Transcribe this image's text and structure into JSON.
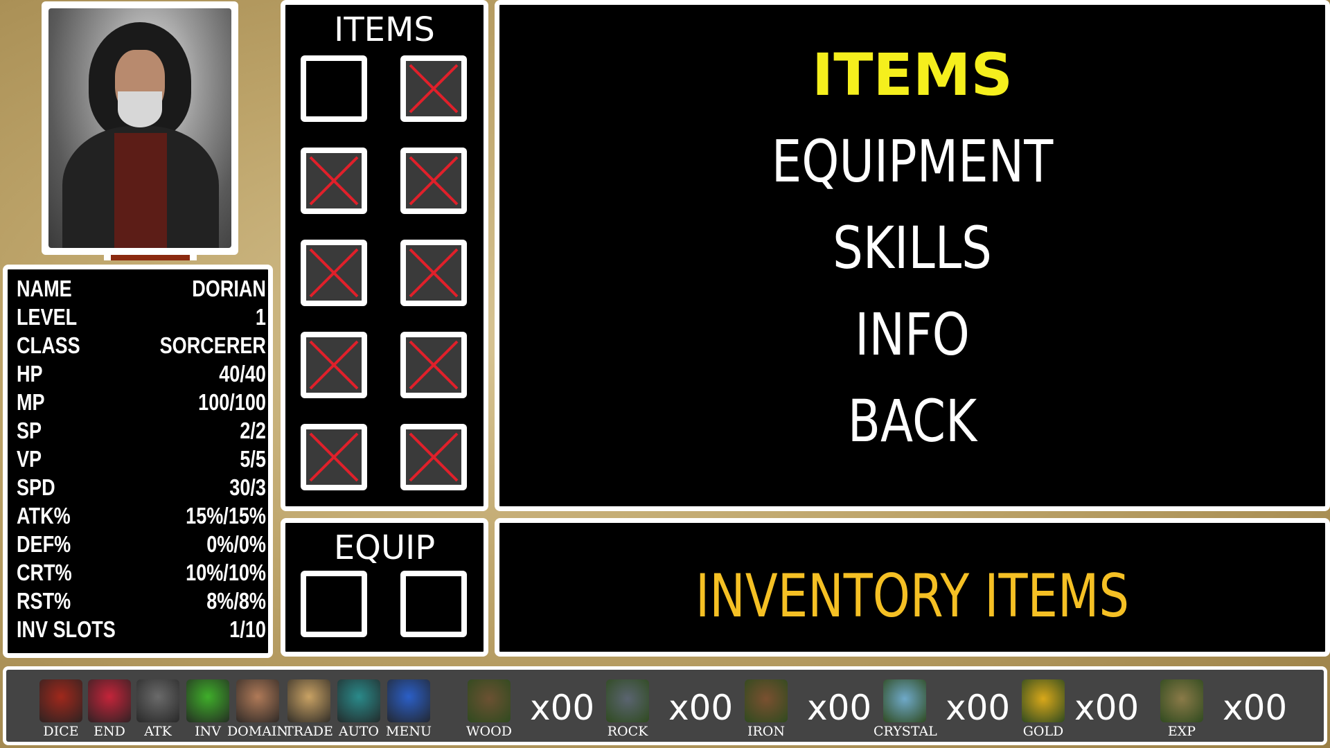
{
  "character": {
    "portrait_alt": "Sorcerer portrait",
    "stats": [
      {
        "label": "NAME",
        "value": "DORIAN"
      },
      {
        "label": "LEVEL",
        "value": "1"
      },
      {
        "label": "CLASS",
        "value": "SORCERER"
      },
      {
        "label": "HP",
        "value": "40/40"
      },
      {
        "label": "MP",
        "value": "100/100"
      },
      {
        "label": "SP",
        "value": "2/2"
      },
      {
        "label": "VP",
        "value": "5/5"
      },
      {
        "label": "SPD",
        "value": "30/3"
      },
      {
        "label": "ATK%",
        "value": "15%/15%"
      },
      {
        "label": "DEF%",
        "value": "0%/0%"
      },
      {
        "label": "CRT%",
        "value": "10%/10%"
      },
      {
        "label": "RST%",
        "value": "8%/8%"
      },
      {
        "label": "INV SLOTS",
        "value": "1/10"
      }
    ]
  },
  "items_panel": {
    "title": "ITEMS",
    "slots": [
      "empty",
      "locked",
      "locked",
      "locked",
      "locked",
      "locked",
      "locked",
      "locked",
      "locked",
      "locked"
    ]
  },
  "equip_panel": {
    "title": "EQUIP",
    "slots": [
      "empty",
      "empty"
    ]
  },
  "menu": {
    "items": [
      {
        "label": "ITEMS",
        "active": true
      },
      {
        "label": "EQUIPMENT",
        "active": false
      },
      {
        "label": "SKILLS",
        "active": false
      },
      {
        "label": "INFO",
        "active": false
      },
      {
        "label": "BACK",
        "active": false
      }
    ]
  },
  "info": {
    "text": "INVENTORY ITEMS"
  },
  "action_bar": [
    {
      "label": "DICE",
      "icon": "dice-icon",
      "color": "#a0281c"
    },
    {
      "label": "END",
      "icon": "end-turn-icon",
      "color": "#c4243a"
    },
    {
      "label": "ATK",
      "icon": "crossed-swords-icon",
      "color": "#6a6a6a"
    },
    {
      "label": "INV",
      "icon": "backpack-icon",
      "color": "#3fae2a"
    },
    {
      "label": "DOMAIN",
      "icon": "castle-icon",
      "color": "#b07a58"
    },
    {
      "label": "TRADE",
      "icon": "trade-icon",
      "color": "#c9a264"
    },
    {
      "label": "AUTO",
      "icon": "auto-icon",
      "color": "#2a8a8a"
    },
    {
      "label": "MENU",
      "icon": "gear-icon",
      "color": "#2b5fc7"
    }
  ],
  "resources": [
    {
      "label": "WOOD",
      "icon": "wood-icon",
      "count": "x00",
      "color": "#6b5132"
    },
    {
      "label": "ROCK",
      "icon": "rock-icon",
      "count": "x00",
      "color": "#5a6470"
    },
    {
      "label": "IRON",
      "icon": "iron-icon",
      "count": "x00",
      "color": "#7a5030"
    },
    {
      "label": "CRYSTAL",
      "icon": "crystal-icon",
      "count": "x00",
      "color": "#6fa9c9"
    },
    {
      "label": "GOLD",
      "icon": "gold-icon",
      "count": "x00",
      "color": "#d9a81a"
    },
    {
      "label": "EXP",
      "icon": "exp-icon",
      "count": "x00",
      "color": "#8a7a48"
    }
  ]
}
